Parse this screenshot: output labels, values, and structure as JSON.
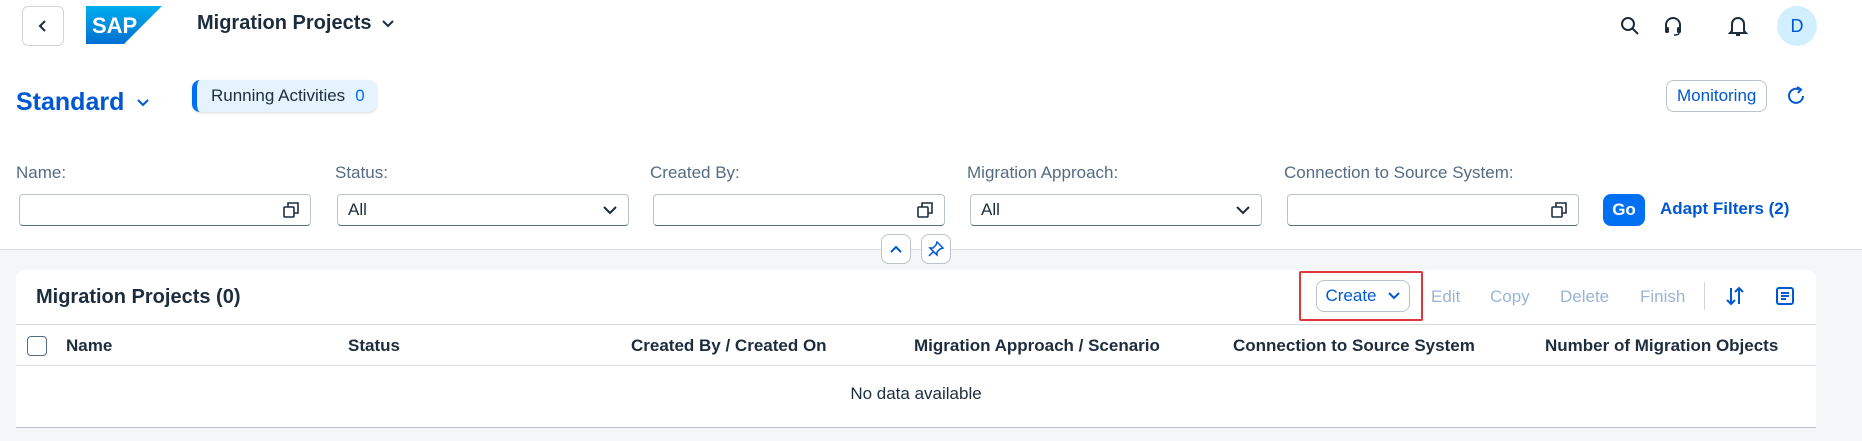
{
  "shell": {
    "title": "Migration Projects",
    "avatar_initial": "D",
    "icons": [
      "back-icon",
      "search-icon",
      "headset-icon",
      "bell-icon"
    ]
  },
  "header": {
    "variant": "Standard",
    "running_label": "Running Activities",
    "running_count": "0",
    "monitoring_label": "Monitoring"
  },
  "filters": {
    "name_label": "Name:",
    "name_value": "",
    "status_label": "Status:",
    "status_value": "All",
    "created_by_label": "Created By:",
    "created_by_value": "",
    "approach_label": "Migration Approach:",
    "approach_value": "All",
    "connection_label": "Connection to Source System:",
    "connection_value": "",
    "go_label": "Go",
    "adapt_label": "Adapt Filters (2)"
  },
  "table": {
    "title": "Migration Projects (0)",
    "create_label": "Create",
    "actions": [
      "Edit",
      "Copy",
      "Delete",
      "Finish"
    ],
    "columns": [
      "Name",
      "Status",
      "Created By / Created On",
      "Migration Approach / Scenario",
      "Connection to Source System",
      "Number of Migration Objects"
    ],
    "empty_text": "No data available"
  },
  "colors": {
    "brand": "#0070f2",
    "link": "#0057d2",
    "highlight": "#e0353d"
  }
}
